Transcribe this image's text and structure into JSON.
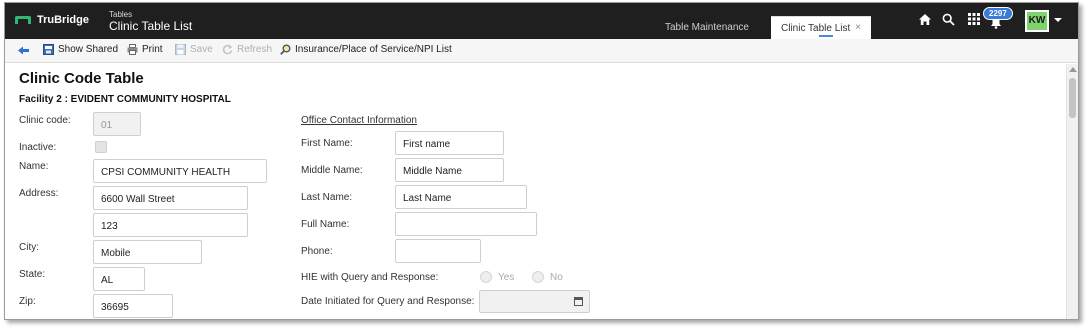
{
  "topbar": {
    "brand": "TruBridge",
    "crumb_small": "Tables",
    "crumb_title": "Clinic Table List",
    "tabs": [
      {
        "label": "Table Maintenance"
      },
      {
        "label": "Clinic Table List",
        "close": "×"
      }
    ],
    "notifications_count": "2297",
    "avatar_initials": "KW",
    "icons": [
      "home-icon",
      "search-icon",
      "apps-grid-icon",
      "bell-icon"
    ]
  },
  "toolbar": {
    "show_shared": "Show Shared",
    "print": "Print",
    "save": "Save",
    "refresh": "Refresh",
    "insurance": "Insurance/Place of Service/NPI List"
  },
  "main": {
    "title": "Clinic Code Table",
    "facility": "Facility 2 : EVIDENT COMMUNITY HOSPITAL",
    "left": {
      "clinic_code_label": "Clinic code:",
      "clinic_code_value": "01",
      "inactive_label": "Inactive:",
      "name_label": "Name:",
      "name_value": "CPSI COMMUNITY HEALTH",
      "address_label": "Address:",
      "address1_value": "6600 Wall Street",
      "address2_value": "123",
      "city_label": "City:",
      "city_value": "Mobile",
      "state_label": "State:",
      "state_value": "AL",
      "zip_label": "Zip:",
      "zip_value": "36695"
    },
    "right": {
      "section_title": "Office Contact Information",
      "first_name_label": "First Name:",
      "first_name_value": "First name",
      "middle_name_label": "Middle Name:",
      "middle_name_value": "Middle Name",
      "last_name_label": "Last Name:",
      "last_name_value": "Last Name",
      "full_name_label": "Full Name:",
      "full_name_value": "",
      "phone_label": "Phone:",
      "phone_value": "",
      "hie_label": "HIE with Query and Response:",
      "hie_yes": "Yes",
      "hie_no": "No",
      "date_label": "Date Initiated for Query and Response:"
    }
  },
  "colors": {
    "topbar_bg": "#1f1f1f",
    "brand_green": "#2eb872",
    "avatar_bg": "#7fd36e",
    "badge_blue": "#3b7bd8"
  }
}
